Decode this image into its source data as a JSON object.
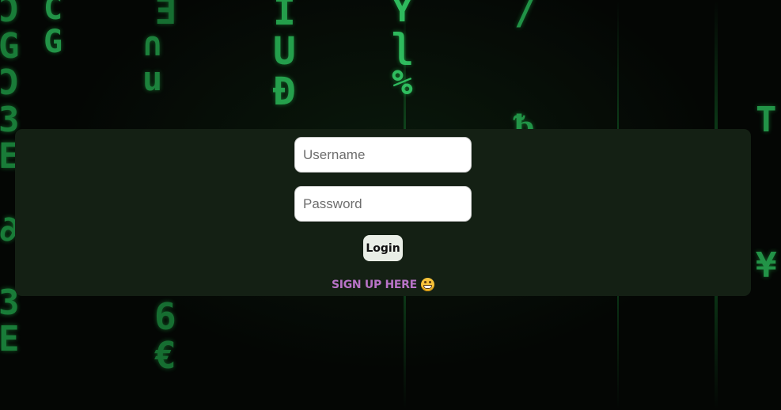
{
  "login_form": {
    "username_placeholder": "Username",
    "password_placeholder": "Password",
    "login_label": "Login",
    "signup_label": "SIGN UP HERE",
    "signup_icon": "grinning-face-emoji"
  },
  "background": {
    "style": "matrix-digital-rain",
    "glyph_columns": [
      "Ͻ\nG\nƆ\n3\nE\n\n∂\n\n3\nE",
      "C\nG\n\n\n\n\n\n\nÇ\n\n",
      "\n∩\nu\n\n\n\n\n\n\n",
      "Ǝ\n\n\n\n\n\n\nb\n6\n€",
      "Ì\nU\nÐ\n\n\n\nGÄ\n\n",
      "Y\nʅ\n%\n\n\n\n\n\n",
      "/\n\n\nᵬ\n\n\n\n\n",
      "\n\n\n\n\n\n\n\n",
      "\n\n\n\n\n\n\n",
      "\n\n\nT\n\n\n\n¥",
      "\n\n\n\n\n\n\n\n"
    ],
    "accent_color": "#22c55e"
  },
  "colors": {
    "panel": "#142014",
    "signup_text": "#b873c7",
    "button_bg": "#e9eee6"
  }
}
